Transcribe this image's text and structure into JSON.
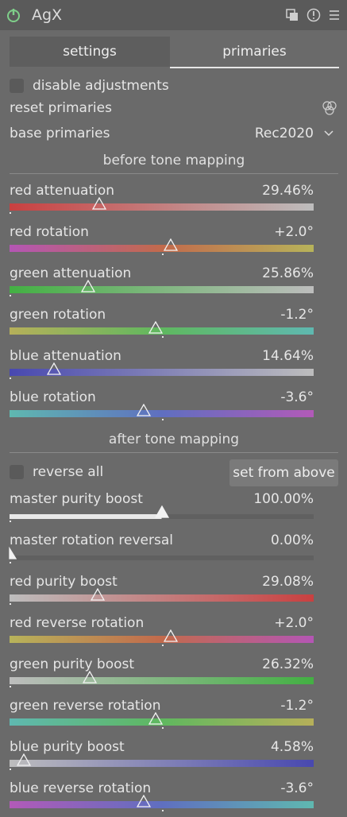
{
  "header": {
    "title": "AgX"
  },
  "tabs": [
    {
      "label": "settings"
    },
    {
      "label": "primaries"
    }
  ],
  "disable_adjustments": {
    "label": "disable adjustments",
    "checked": false
  },
  "reset_primaries": {
    "label": "reset primaries"
  },
  "base_primaries": {
    "label": "base primaries",
    "value": "Rec2020"
  },
  "sections": {
    "before": "before tone mapping",
    "after": "after tone mapping"
  },
  "reverse_all": {
    "label": "reverse all",
    "checked": false
  },
  "set_from_above": {
    "label": "set from above"
  },
  "sliders": [
    {
      "label": "red attenuation",
      "value": "29.46%",
      "level": 0.2946
    },
    {
      "label": "red rotation",
      "value": "+2.0°",
      "level": 0.53
    },
    {
      "label": "green attenuation",
      "value": "25.86%",
      "level": 0.2586
    },
    {
      "label": "green rotation",
      "value": "-1.2°",
      "level": 0.48
    },
    {
      "label": "blue attenuation",
      "value": "14.64%",
      "level": 0.1464
    },
    {
      "label": "blue rotation",
      "value": "-3.6°",
      "level": 0.44
    },
    {
      "label": "master purity boost",
      "value": "100.00%",
      "level": 0.5
    },
    {
      "label": "master rotation reversal",
      "value": "0.00%",
      "level": 0.0
    },
    {
      "label": "red purity boost",
      "value": "29.08%",
      "level": 0.2908
    },
    {
      "label": "red reverse rotation",
      "value": "+2.0°",
      "level": 0.53
    },
    {
      "label": "green purity boost",
      "value": "26.32%",
      "level": 0.2632
    },
    {
      "label": "green reverse rotation",
      "value": "-1.2°",
      "level": 0.48
    },
    {
      "label": "blue purity boost",
      "value": "4.58%",
      "level": 0.0458
    },
    {
      "label": "blue reverse rotation",
      "value": "-3.6°",
      "level": 0.44
    }
  ],
  "colors": {
    "background": "#6a6a6a",
    "header": "#5a5a5a",
    "power_icon": "#7fcf8a"
  }
}
